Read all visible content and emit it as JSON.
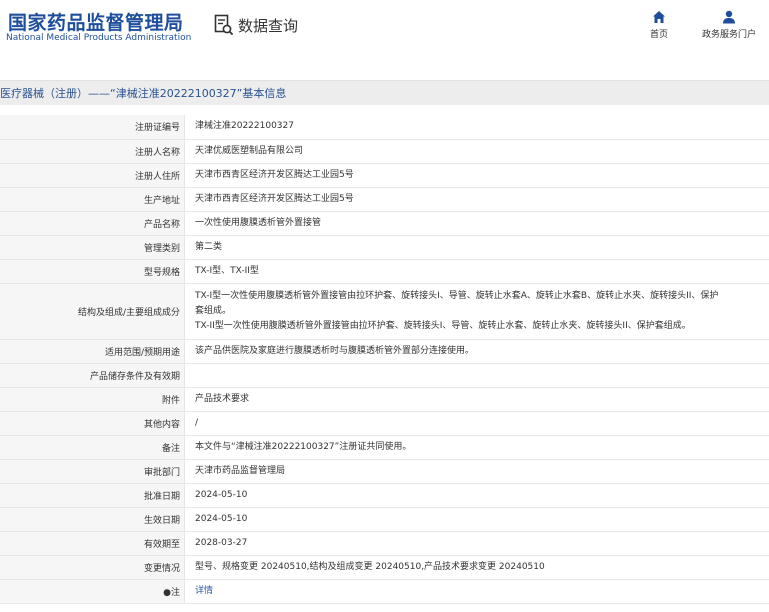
{
  "header": {
    "site_title": "国家药品监督管理局",
    "site_subtitle": "National Medical Products Administration",
    "query_label": "数据查询",
    "nav": [
      {
        "label": "首页",
        "icon": "home-icon"
      },
      {
        "label": "政务服务门户",
        "icon": "user-icon"
      }
    ]
  },
  "page_title": "医疗器械（注册）——“津械注准20222100327”基本信息",
  "rows": [
    {
      "label": "注册证编号",
      "value": "津械注准20222100327"
    },
    {
      "label": "注册人名称",
      "value": "天津优威医塑制品有限公司"
    },
    {
      "label": "注册人住所",
      "value": "天津市西青区经济开发区腾达工业园5号"
    },
    {
      "label": "生产地址",
      "value": "天津市西青区经济开发区腾达工业园5号"
    },
    {
      "label": "产品名称",
      "value": "一次性使用腹膜透析管外置接管"
    },
    {
      "label": "管理类别",
      "value": "第二类"
    },
    {
      "label": "型号规格",
      "value": "TX-I型、TX-II型"
    },
    {
      "label": "结构及组成/主要组成成分",
      "lines": [
        "TX-I型一次性使用腹膜透析管外置接管由拉环护套、旋转接头I、导管、旋转止水套A、旋转止水套B、旋转止水夹、旋转接头II、保护",
        "套组成。",
        "TX-II型一次性使用腹膜透析管外置接管由拉环护套、旋转接头I、导管、旋转止水套、旋转止水夹、旋转接头II、保护套组成。"
      ]
    },
    {
      "label": "适用范围/预期用途",
      "value": "该产品供医院及家庭进行腹膜透析时与腹膜透析管外置部分连接使用。"
    },
    {
      "label": "产品储存条件及有效期",
      "value": ""
    },
    {
      "label": "附件",
      "value": "产品技术要求"
    },
    {
      "label": "其他内容",
      "value": "/"
    },
    {
      "label": "备注",
      "value": "本文件与“津械注准20222100327”注册证共同使用。"
    },
    {
      "label": "审批部门",
      "value": "天津市药品监督管理局"
    },
    {
      "label": "批准日期",
      "value": "2024-05-10"
    },
    {
      "label": "生效日期",
      "value": "2024-05-10"
    },
    {
      "label": "有效期至",
      "value": "2028-03-27"
    },
    {
      "label": "变更情况",
      "value": "型号、规格变更 20240510,结构及组成变更 20240510,产品技术要求变更 20240510"
    },
    {
      "label": "●注",
      "value": "详情",
      "link": true
    }
  ]
}
